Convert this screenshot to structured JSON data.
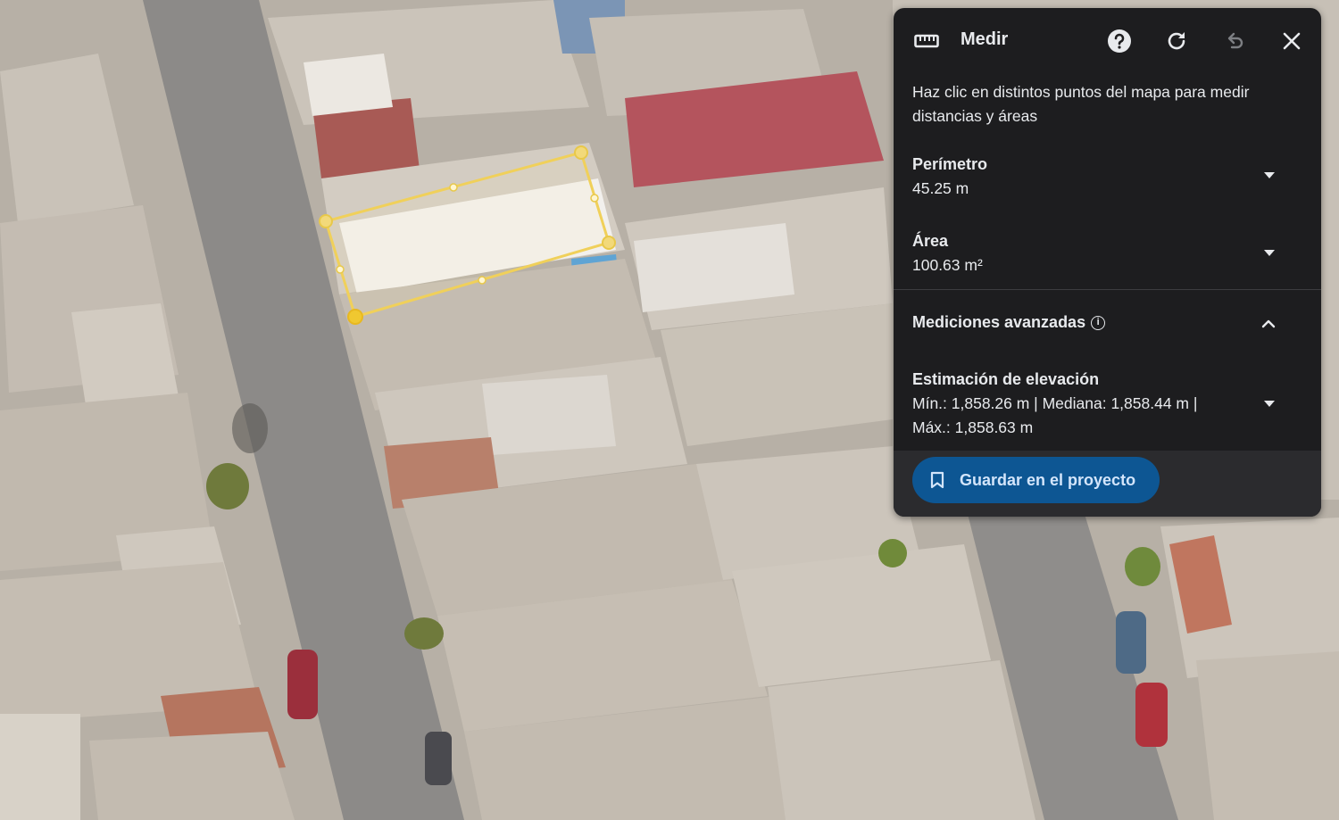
{
  "panel": {
    "title": "Medir",
    "instructions": "Haz clic en distintos puntos del mapa para medir distancias y áreas",
    "perimeter": {
      "label": "Perímetro",
      "value": "45.25 m"
    },
    "area": {
      "label": "Área",
      "value": "100.63 m²"
    },
    "advanced": {
      "label": "Mediciones avanzadas"
    },
    "elevation": {
      "label": "Estimación de elevación",
      "line1": "Mín.: 1,858.26 m | Mediana: 1,858.44 m |",
      "line2": "Máx.: 1,858.63 m"
    },
    "save_label": "Guardar en el proyecto"
  },
  "colors": {
    "panel_bg": "#1d1d1f",
    "button_bg": "#0d5693",
    "measure_outline": "#f0d05a",
    "map_base": "#b9b2a8"
  },
  "icons": [
    "ruler-icon",
    "help-icon",
    "refresh-icon",
    "undo-icon",
    "close-icon",
    "info-icon",
    "chevron-up-icon",
    "caret-down-icon",
    "bookmark-icon"
  ]
}
